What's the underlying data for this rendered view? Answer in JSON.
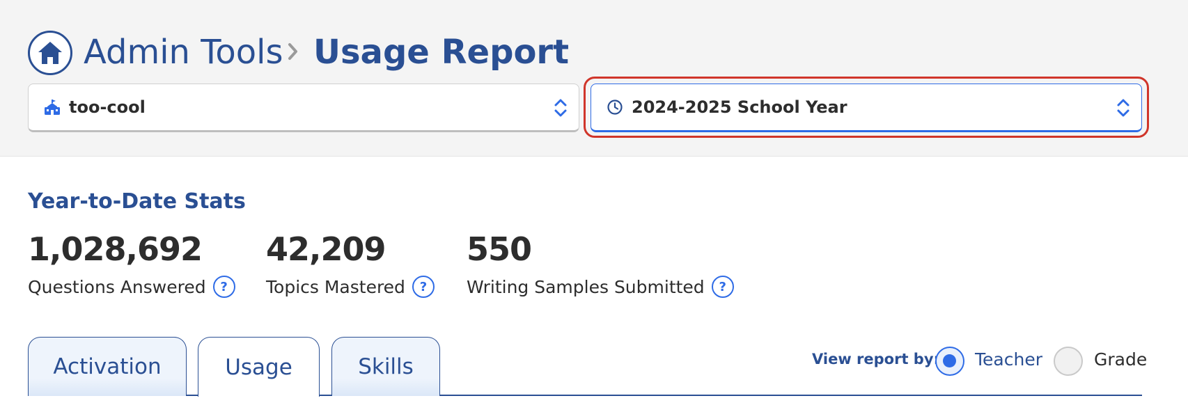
{
  "breadcrumb": {
    "home_icon": "home-icon",
    "root": "Admin Tools",
    "separator_icon": "chevron-right-icon",
    "current": "Usage Report"
  },
  "filters": {
    "school": {
      "icon": "school-icon",
      "value": "too-cool"
    },
    "year": {
      "icon": "clock-icon",
      "value": "2024-2025 School Year"
    }
  },
  "stats": {
    "title": "Year-to-Date Stats",
    "items": [
      {
        "value": "1,028,692",
        "label": "Questions Answered"
      },
      {
        "value": "42,209",
        "label": "Topics Mastered"
      },
      {
        "value": "550",
        "label": "Writing Samples Submitted"
      }
    ],
    "help_glyph": "?"
  },
  "tabs": [
    {
      "label": "Activation",
      "active": false
    },
    {
      "label": "Usage",
      "active": true
    },
    {
      "label": "Skills",
      "active": false
    }
  ],
  "view_report": {
    "label": "View report by:",
    "options": [
      {
        "label": "Teacher",
        "selected": true
      },
      {
        "label": "Grade",
        "selected": false
      }
    ]
  },
  "colors": {
    "brand_navy": "#2a4f93",
    "accent_blue": "#2e6be6",
    "highlight_red": "#d0352a"
  }
}
